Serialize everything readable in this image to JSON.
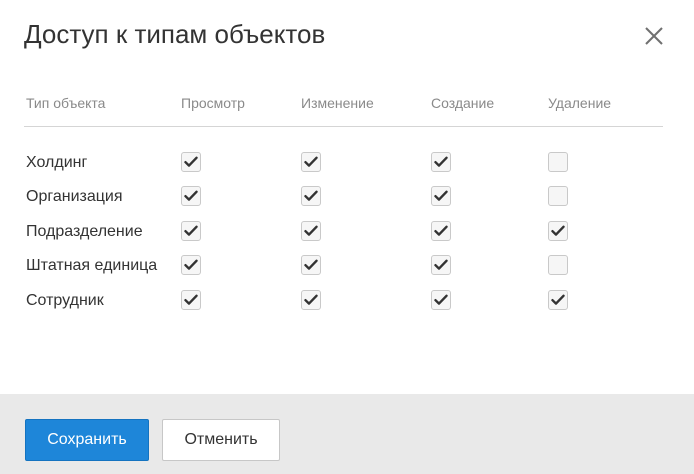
{
  "dialog": {
    "title": "Доступ к типам объектов",
    "close_icon": "close-icon"
  },
  "table": {
    "columns": [
      "Тип объекта",
      "Просмотр",
      "Изменение",
      "Создание",
      "Удаление"
    ],
    "rows": [
      {
        "label": "Холдинг",
        "view": true,
        "edit": true,
        "create": true,
        "delete": false
      },
      {
        "label": "Организация",
        "view": true,
        "edit": true,
        "create": true,
        "delete": false
      },
      {
        "label": "Подразделение",
        "view": true,
        "edit": true,
        "create": true,
        "delete": true
      },
      {
        "label": "Штатная единица",
        "view": true,
        "edit": true,
        "create": true,
        "delete": false
      },
      {
        "label": "Сотрудник",
        "view": true,
        "edit": true,
        "create": true,
        "delete": true
      }
    ]
  },
  "footer": {
    "save_label": "Сохранить",
    "cancel_label": "Отменить"
  },
  "colors": {
    "primary": "#1e86d9",
    "footer_bg": "#e9e9e9",
    "header_text": "#8a8a8a"
  }
}
